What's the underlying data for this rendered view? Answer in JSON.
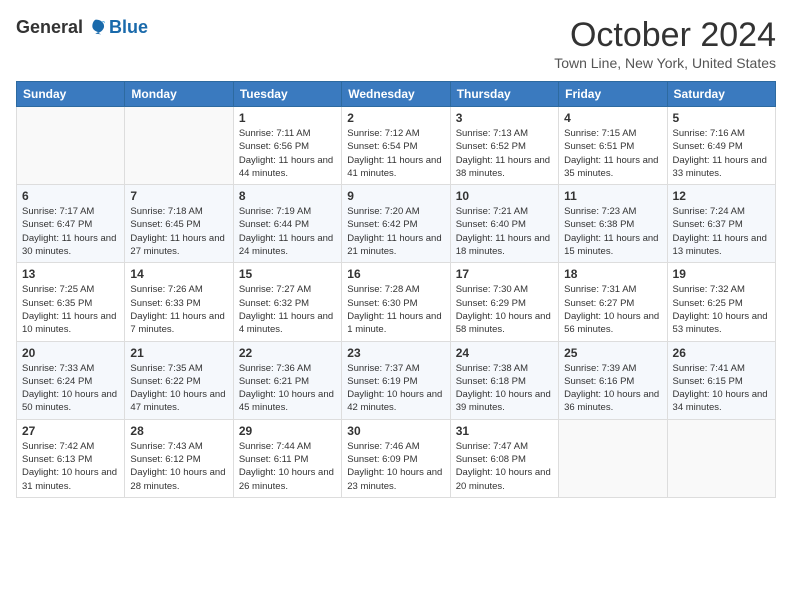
{
  "logo": {
    "general": "General",
    "blue": "Blue"
  },
  "title": "October 2024",
  "location": "Town Line, New York, United States",
  "days_of_week": [
    "Sunday",
    "Monday",
    "Tuesday",
    "Wednesday",
    "Thursday",
    "Friday",
    "Saturday"
  ],
  "weeks": [
    [
      {
        "day": "",
        "info": ""
      },
      {
        "day": "",
        "info": ""
      },
      {
        "day": "1",
        "info": "Sunrise: 7:11 AM\nSunset: 6:56 PM\nDaylight: 11 hours and 44 minutes."
      },
      {
        "day": "2",
        "info": "Sunrise: 7:12 AM\nSunset: 6:54 PM\nDaylight: 11 hours and 41 minutes."
      },
      {
        "day": "3",
        "info": "Sunrise: 7:13 AM\nSunset: 6:52 PM\nDaylight: 11 hours and 38 minutes."
      },
      {
        "day": "4",
        "info": "Sunrise: 7:15 AM\nSunset: 6:51 PM\nDaylight: 11 hours and 35 minutes."
      },
      {
        "day": "5",
        "info": "Sunrise: 7:16 AM\nSunset: 6:49 PM\nDaylight: 11 hours and 33 minutes."
      }
    ],
    [
      {
        "day": "6",
        "info": "Sunrise: 7:17 AM\nSunset: 6:47 PM\nDaylight: 11 hours and 30 minutes."
      },
      {
        "day": "7",
        "info": "Sunrise: 7:18 AM\nSunset: 6:45 PM\nDaylight: 11 hours and 27 minutes."
      },
      {
        "day": "8",
        "info": "Sunrise: 7:19 AM\nSunset: 6:44 PM\nDaylight: 11 hours and 24 minutes."
      },
      {
        "day": "9",
        "info": "Sunrise: 7:20 AM\nSunset: 6:42 PM\nDaylight: 11 hours and 21 minutes."
      },
      {
        "day": "10",
        "info": "Sunrise: 7:21 AM\nSunset: 6:40 PM\nDaylight: 11 hours and 18 minutes."
      },
      {
        "day": "11",
        "info": "Sunrise: 7:23 AM\nSunset: 6:38 PM\nDaylight: 11 hours and 15 minutes."
      },
      {
        "day": "12",
        "info": "Sunrise: 7:24 AM\nSunset: 6:37 PM\nDaylight: 11 hours and 13 minutes."
      }
    ],
    [
      {
        "day": "13",
        "info": "Sunrise: 7:25 AM\nSunset: 6:35 PM\nDaylight: 11 hours and 10 minutes."
      },
      {
        "day": "14",
        "info": "Sunrise: 7:26 AM\nSunset: 6:33 PM\nDaylight: 11 hours and 7 minutes."
      },
      {
        "day": "15",
        "info": "Sunrise: 7:27 AM\nSunset: 6:32 PM\nDaylight: 11 hours and 4 minutes."
      },
      {
        "day": "16",
        "info": "Sunrise: 7:28 AM\nSunset: 6:30 PM\nDaylight: 11 hours and 1 minute."
      },
      {
        "day": "17",
        "info": "Sunrise: 7:30 AM\nSunset: 6:29 PM\nDaylight: 10 hours and 58 minutes."
      },
      {
        "day": "18",
        "info": "Sunrise: 7:31 AM\nSunset: 6:27 PM\nDaylight: 10 hours and 56 minutes."
      },
      {
        "day": "19",
        "info": "Sunrise: 7:32 AM\nSunset: 6:25 PM\nDaylight: 10 hours and 53 minutes."
      }
    ],
    [
      {
        "day": "20",
        "info": "Sunrise: 7:33 AM\nSunset: 6:24 PM\nDaylight: 10 hours and 50 minutes."
      },
      {
        "day": "21",
        "info": "Sunrise: 7:35 AM\nSunset: 6:22 PM\nDaylight: 10 hours and 47 minutes."
      },
      {
        "day": "22",
        "info": "Sunrise: 7:36 AM\nSunset: 6:21 PM\nDaylight: 10 hours and 45 minutes."
      },
      {
        "day": "23",
        "info": "Sunrise: 7:37 AM\nSunset: 6:19 PM\nDaylight: 10 hours and 42 minutes."
      },
      {
        "day": "24",
        "info": "Sunrise: 7:38 AM\nSunset: 6:18 PM\nDaylight: 10 hours and 39 minutes."
      },
      {
        "day": "25",
        "info": "Sunrise: 7:39 AM\nSunset: 6:16 PM\nDaylight: 10 hours and 36 minutes."
      },
      {
        "day": "26",
        "info": "Sunrise: 7:41 AM\nSunset: 6:15 PM\nDaylight: 10 hours and 34 minutes."
      }
    ],
    [
      {
        "day": "27",
        "info": "Sunrise: 7:42 AM\nSunset: 6:13 PM\nDaylight: 10 hours and 31 minutes."
      },
      {
        "day": "28",
        "info": "Sunrise: 7:43 AM\nSunset: 6:12 PM\nDaylight: 10 hours and 28 minutes."
      },
      {
        "day": "29",
        "info": "Sunrise: 7:44 AM\nSunset: 6:11 PM\nDaylight: 10 hours and 26 minutes."
      },
      {
        "day": "30",
        "info": "Sunrise: 7:46 AM\nSunset: 6:09 PM\nDaylight: 10 hours and 23 minutes."
      },
      {
        "day": "31",
        "info": "Sunrise: 7:47 AM\nSunset: 6:08 PM\nDaylight: 10 hours and 20 minutes."
      },
      {
        "day": "",
        "info": ""
      },
      {
        "day": "",
        "info": ""
      }
    ]
  ]
}
